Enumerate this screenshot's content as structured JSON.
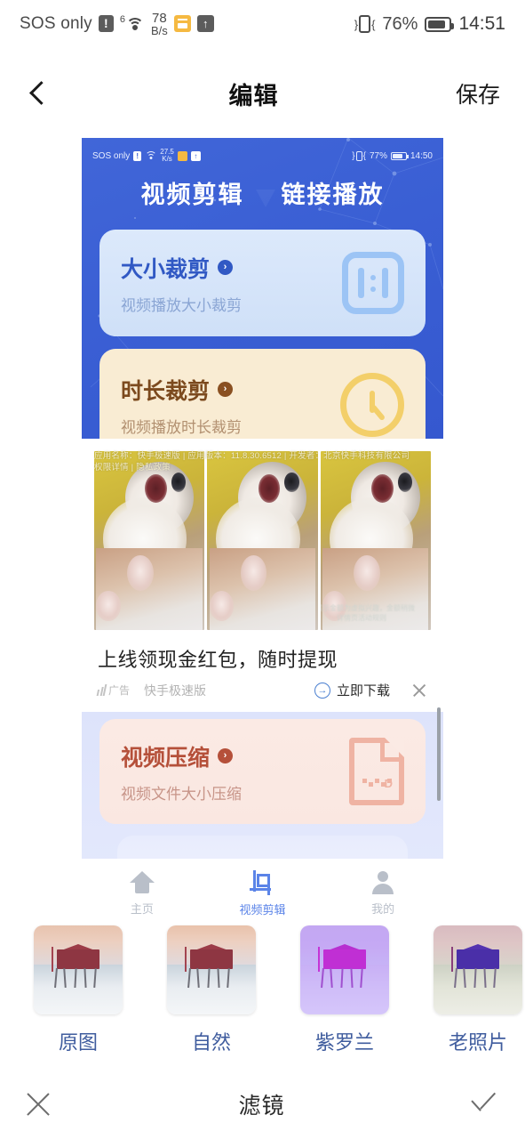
{
  "status_bar": {
    "carrier": "SOS only",
    "alert_icon": "!",
    "wifi_gen": "6",
    "wifi_icon": "wifi-icon",
    "net_speed_value": "78",
    "net_speed_unit": "B/s",
    "orange_icon": "wallet-icon",
    "upload_icon": "↑",
    "vibrate_icon": "vibrate-icon",
    "battery_percent": "76%",
    "clock": "14:51"
  },
  "app_bar": {
    "back_icon": "back-chevron-icon",
    "title": "编辑",
    "save_label": "保存"
  },
  "preview": {
    "inner_status": {
      "carrier": "SOS only",
      "alert_icon": "!",
      "speed_value": "27.5",
      "speed_unit": "K/s",
      "battery_percent": "77%",
      "clock": "14:50"
    },
    "hero_tabs": [
      {
        "label": "视频剪辑"
      },
      {
        "label": "链接播放"
      }
    ],
    "cards": [
      {
        "title": "大小裁剪",
        "subtitle": "视频播放大小裁剪",
        "icon": "aspect-ratio-icon",
        "accent": "#3159c4"
      },
      {
        "title": "时长裁剪",
        "subtitle": "视频播放时长裁剪",
        "icon": "clock-icon",
        "accent": "#8a5021"
      },
      {
        "title": "视频压缩",
        "subtitle": "视频文件大小压缩",
        "icon": "zip-file-icon",
        "accent": "#b5503a"
      }
    ],
    "ad": {
      "legal_line": "应用名称：快手极速版 | 应用版本：11.8.30.6512 | 开发者：北京快手科技有限公司",
      "legal_line2": "权限详情 | 隐私政策",
      "overlay_note": "所展示金额为虚拟兴趣，金额稍微详情页活动规则",
      "headline": "上线领现金红包，随时提现",
      "ad_badge": "广告",
      "brand": "快手极速版",
      "download_label": "立即下载",
      "download_icon": "download-arrow-icon",
      "close_icon": "close-icon"
    },
    "bottom_nav": [
      {
        "label": "主页",
        "icon": "home-icon",
        "active": false
      },
      {
        "label": "视频剪辑",
        "icon": "crop-icon",
        "active": true
      },
      {
        "label": "我的",
        "icon": "user-icon",
        "active": false
      }
    ]
  },
  "filters": {
    "items": [
      {
        "label": "原图",
        "selected": true
      },
      {
        "label": "自然",
        "selected": false
      },
      {
        "label": "紫罗兰",
        "selected": false
      },
      {
        "label": "老照片",
        "selected": false
      }
    ]
  },
  "action_bar": {
    "cancel_icon": "close-icon",
    "title": "滤镜",
    "confirm_icon": "check-icon"
  },
  "colors": {
    "hero_blue": "#3a5fd4",
    "accent_blue": "#3f5c9e",
    "nav_active": "#5b84e8",
    "cream": "#f9ecd3",
    "peach": "#fbeae4"
  }
}
